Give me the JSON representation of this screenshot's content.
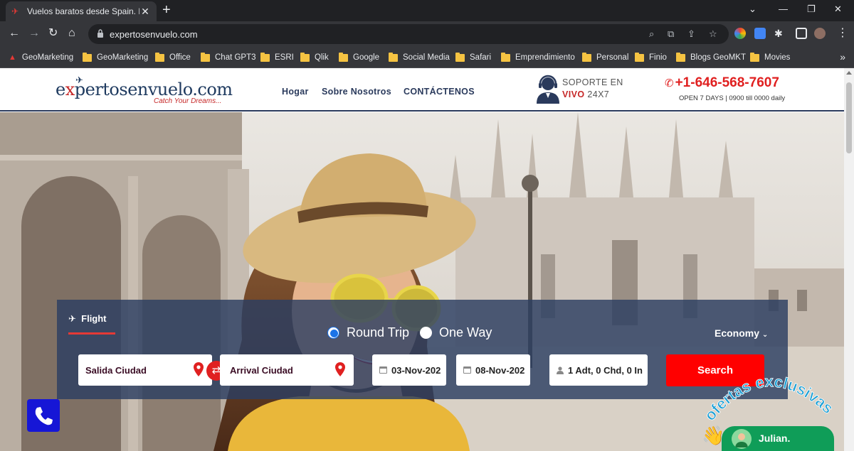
{
  "browser": {
    "tab_title": "Vuelos baratos desde Spain. Res",
    "url": "expertosenvuelo.com",
    "bookmarks": [
      "GeoMarketing",
      "GeoMarketing",
      "Office",
      "Chat GPT3",
      "ESRI",
      "Qlik",
      "Google",
      "Social Media",
      "Safari",
      "Emprendimiento",
      "Personal",
      "Finio",
      "Blogs GeoMKT",
      "Movies"
    ]
  },
  "header": {
    "logo_pre": "e",
    "logo_mid": "x",
    "logo_rest": "pertosenvuelo.com",
    "logo_tagline": "Catch Your Dreams...",
    "nav": [
      "Hogar",
      "Sobre Nosotros",
      "CONTÁCTENOS"
    ],
    "support_line1": "SOPORTE EN",
    "support_vivo": "VIVO",
    "support_247": "24X7",
    "phone": "+1-646-568-7607",
    "hours": "OPEN 7 DAYS | 0900 till 0000 daily"
  },
  "search": {
    "tab_label": "Flight",
    "trip_round": "Round Trip",
    "trip_oneway": "One Way",
    "cabin": "Economy",
    "origin": "Salida Ciudad",
    "destination": "Arrival Ciudad",
    "depart_date": "03-Nov-202",
    "return_date": "08-Nov-202",
    "travellers": "1 Adt, 0 Chd, 0 In",
    "button": "Search"
  },
  "widgets": {
    "promo": "ofertas exclusivas",
    "chat_name": "Julian."
  },
  "colors": {
    "accent_red": "#e02020",
    "navy": "#2a3a5c",
    "panel": "#2c3e62",
    "chat_green": "#0f9d58",
    "call_blue": "#1616d6"
  }
}
